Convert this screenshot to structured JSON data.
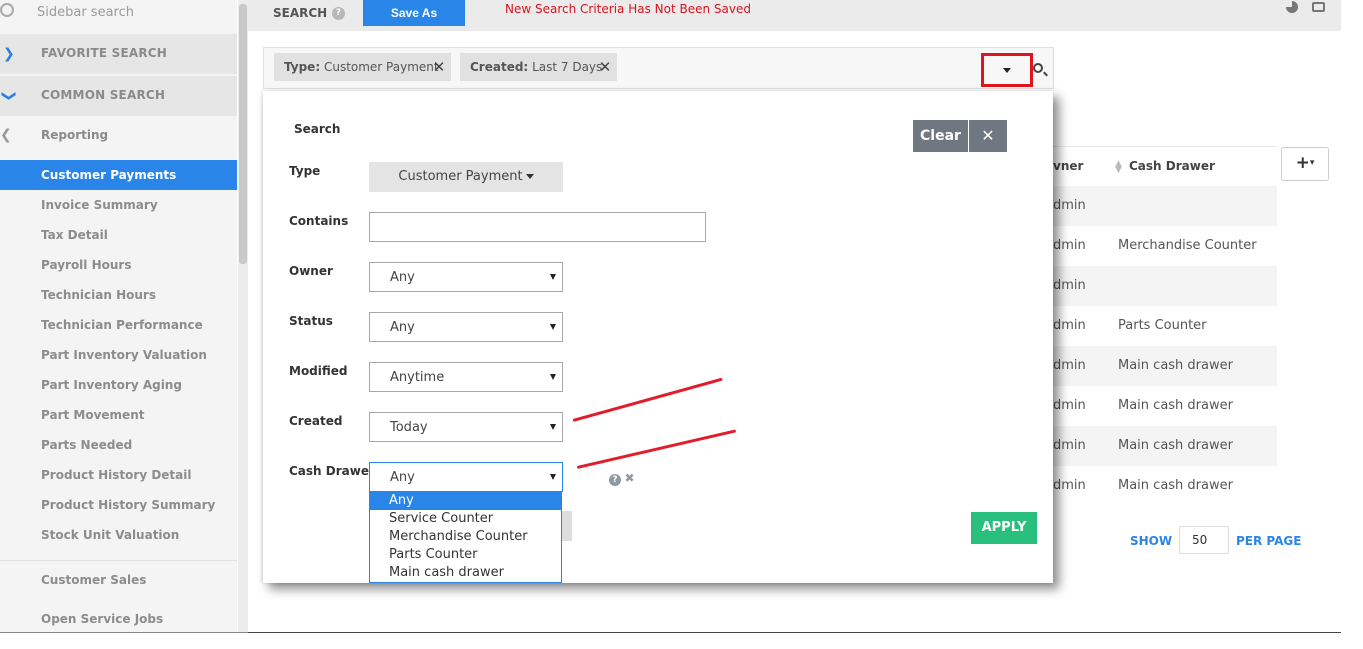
{
  "sidebar": {
    "search_placeholder": "Sidebar search",
    "favorite_search": "FAVORITE SEARCH",
    "common_search": "COMMON SEARCH",
    "reporting": "Reporting",
    "items": [
      {
        "label": "Customer Payments",
        "active": true
      },
      {
        "label": "Invoice Summary"
      },
      {
        "label": "Tax Detail"
      },
      {
        "label": "Payroll Hours"
      },
      {
        "label": "Technician Hours"
      },
      {
        "label": "Technician Performance"
      },
      {
        "label": "Part Inventory Valuation"
      },
      {
        "label": "Part Inventory Aging"
      },
      {
        "label": "Part Movement"
      },
      {
        "label": "Parts Needed"
      },
      {
        "label": "Product History Detail"
      },
      {
        "label": "Product History Summary"
      },
      {
        "label": "Stock Unit Valuation"
      }
    ],
    "customer_sales": "Customer Sales",
    "open_service_jobs": "Open Service Jobs"
  },
  "topbar": {
    "title": "SEARCH",
    "help": "?",
    "save_as": "Save As",
    "warning": "New Search Criteria Has Not Been Saved"
  },
  "filters": {
    "chip1_key": "Type:",
    "chip1_value": "Customer Payment",
    "chip2_key": "Created:",
    "chip2_value": "Last 7 Days",
    "remove": "✕"
  },
  "panel": {
    "title": "Search",
    "clear": "Clear",
    "close": "✕",
    "apply": "APPLY",
    "labels": {
      "type": "Type",
      "contains": "Contains",
      "owner": "Owner",
      "status": "Status",
      "modified": "Modified",
      "created": "Created",
      "cash_drawer": "Cash Drawer"
    },
    "type_value": "Customer Payment",
    "contains_value": "",
    "owner_value": "Any",
    "status_value": "Any",
    "modified_value": "Anytime",
    "created_value": "Today",
    "cash_drawer_value": "Any",
    "cash_drawer_options": [
      "Any",
      "Service Counter",
      "Merchandise Counter",
      "Parts Counter",
      "Main cash drawer"
    ]
  },
  "table": {
    "columns": [
      "vner",
      "Cash Drawer"
    ],
    "rows": [
      {
        "owner": "dmin",
        "cash_drawer": ""
      },
      {
        "owner": "dmin",
        "cash_drawer": "Merchandise Counter"
      },
      {
        "owner": "dmin",
        "cash_drawer": ""
      },
      {
        "owner": "dmin",
        "cash_drawer": "Parts Counter"
      },
      {
        "owner": "dmin",
        "cash_drawer": "Main cash drawer"
      },
      {
        "owner": "dmin",
        "cash_drawer": "Main cash drawer"
      },
      {
        "owner": "dmin",
        "cash_drawer": "Main cash drawer"
      },
      {
        "owner": "dmin",
        "cash_drawer": "Main cash drawer"
      }
    ]
  },
  "pagination": {
    "show": "SHOW",
    "per_page_value": "50",
    "per_page": "PER PAGE"
  },
  "colors": {
    "accent": "#2a85e8",
    "warning": "#d8141d",
    "apply": "#28c07c",
    "annotation": "#e21c2a"
  }
}
